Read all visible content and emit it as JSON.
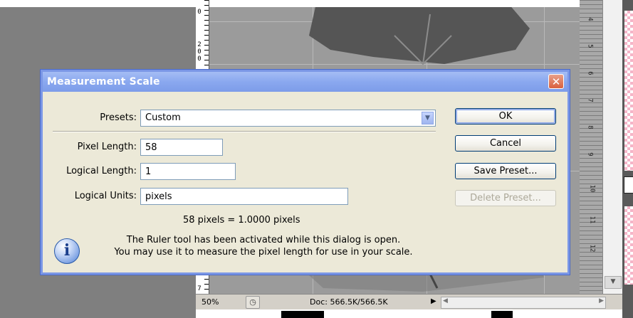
{
  "app": {
    "left_ruler_labels": [
      "0",
      "2",
      "0",
      "0",
      "7"
    ],
    "right_ruler_labels": [
      "4",
      "5",
      "6",
      "7",
      "8",
      "9",
      "10",
      "11",
      "12"
    ],
    "status": {
      "zoom": "50%",
      "doc_info": "Doc: 566.5K/566.5K"
    }
  },
  "dialog": {
    "title": "Measurement Scale",
    "presets": {
      "label": "Presets:",
      "value": "Custom"
    },
    "pixel_length": {
      "label": "Pixel Length:",
      "value": "58"
    },
    "logical_length": {
      "label": "Logical Length:",
      "value": "1"
    },
    "logical_units": {
      "label": "Logical Units:",
      "value": "pixels"
    },
    "equation": "58 pixels = 1.0000 pixels",
    "info_line1": "The Ruler tool has been activated while this dialog is open.",
    "info_line2": "You may use it to measure the pixel length for use in your scale.",
    "buttons": {
      "ok": "OK",
      "cancel": "Cancel",
      "save_preset": "Save Preset...",
      "delete_preset": "Delete Preset..."
    }
  }
}
